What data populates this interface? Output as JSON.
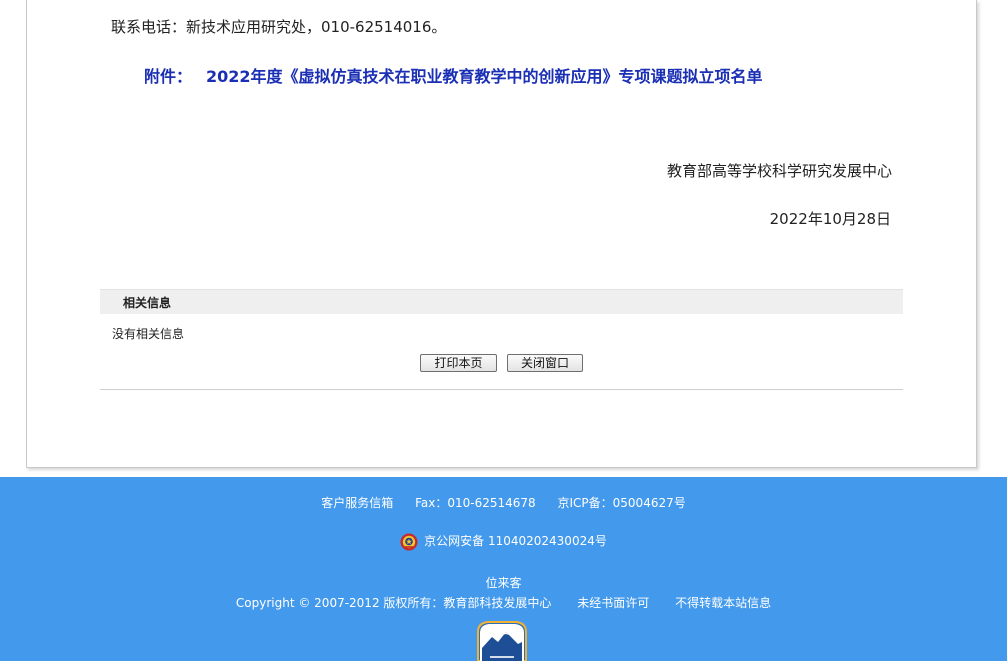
{
  "article": {
    "contact_line": "联系电话：新技术应用研究处，010-62514016。",
    "attachment_label": "附件：",
    "attachment_link": "2022年度《虚拟仿真技术在职业教育教学中的创新应用》专项课题拟立项名单",
    "organization": "教育部高等学校科学研究发展中心",
    "date": "2022年10月28日"
  },
  "related": {
    "title": "相关信息",
    "empty_text": "没有相关信息"
  },
  "buttons": {
    "print": "打印本页",
    "close": "关闭窗口"
  },
  "footer": {
    "service": "客户服务信箱",
    "fax": "Fax：010-62514678",
    "icp": "京ICP备：05004627号",
    "police": "京公网安备 11040202430024号",
    "visitors": "位来客",
    "copyright": "Copyright © 2007-2012 版权所有：教育部科技发展中心",
    "no_permission": "未经书面许可",
    "no_repost": "不得转载本站信息",
    "background_color": "#4399ec",
    "badge_icon": "police-emblem-icon",
    "logo_icon": "site-logo-icon"
  },
  "colors": {
    "attachment_link": "#1a2fb4",
    "text": "#222222",
    "related_bar": "#efefef"
  }
}
